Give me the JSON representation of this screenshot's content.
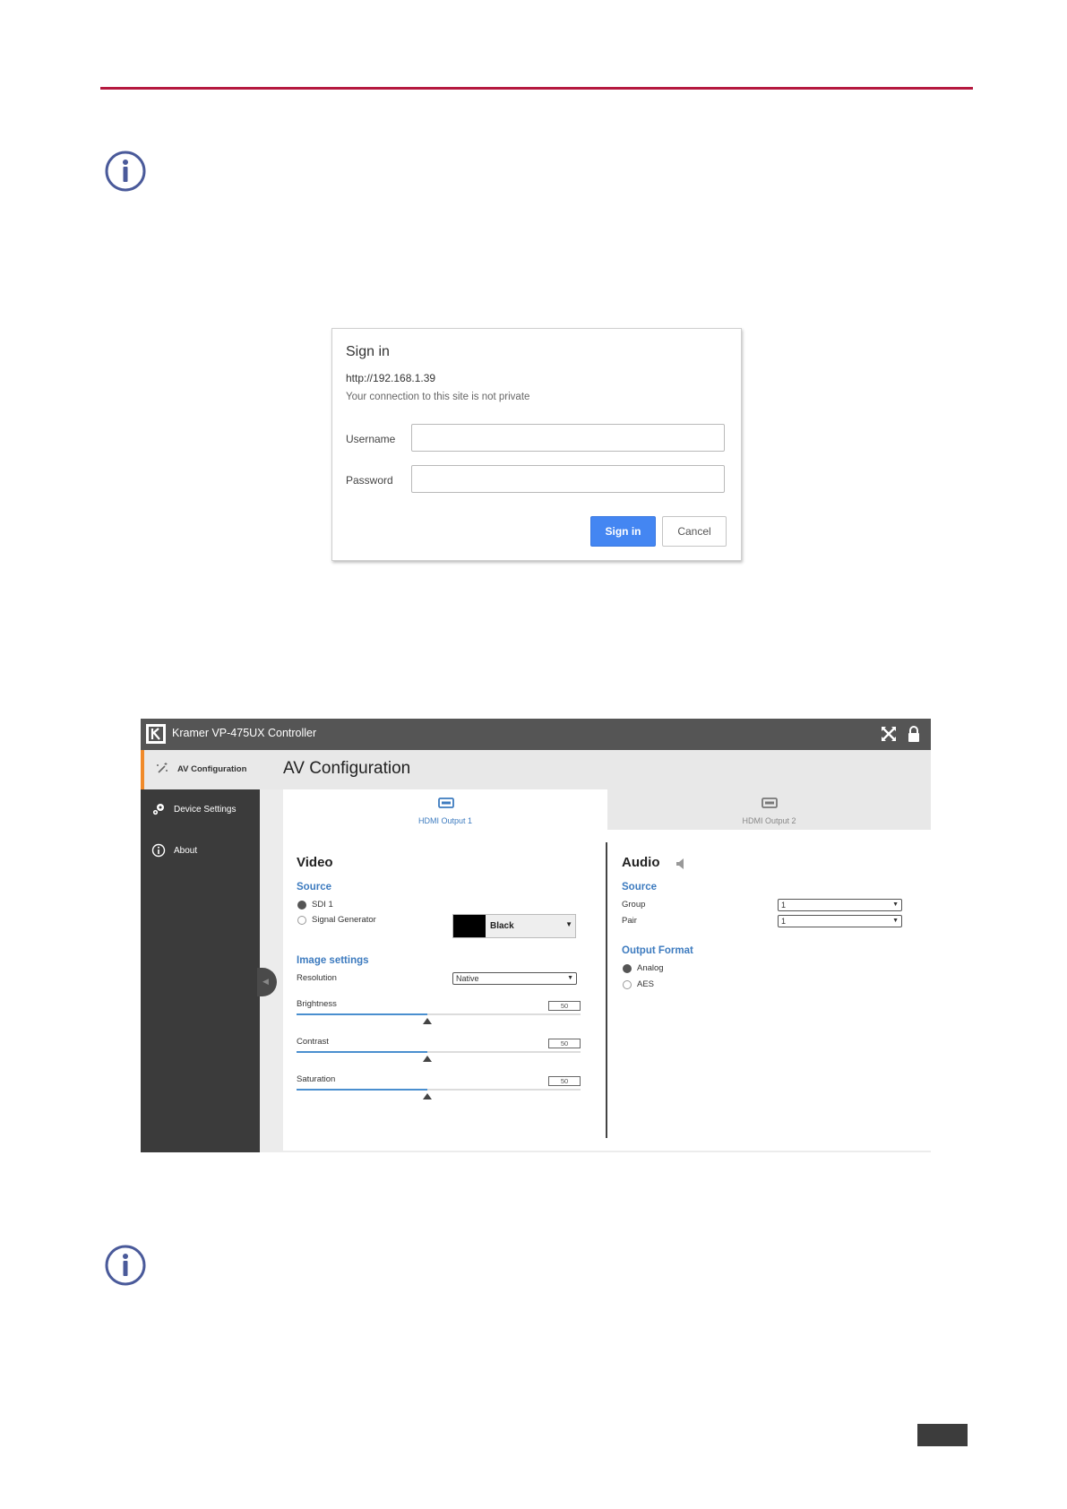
{
  "dialog": {
    "title": "Sign in",
    "url": "http://192.168.1.39",
    "warning": "Your connection to this site is not private",
    "username_label": "Username",
    "username_value": "",
    "password_label": "Password",
    "password_value": "",
    "signin_button": "Sign in",
    "cancel_button": "Cancel"
  },
  "controller": {
    "title": "Kramer VP-475UX Controller",
    "sidebar": {
      "items": [
        {
          "label": "AV Configuration",
          "icon": "wand-icon",
          "active": true
        },
        {
          "label": "Device Settings",
          "icon": "gears-icon",
          "active": false
        },
        {
          "label": "About",
          "icon": "info-icon",
          "active": false
        }
      ]
    },
    "page_title": "AV Configuration",
    "tabs": [
      {
        "label": "HDMI Output 1",
        "icon": "hdmi-icon",
        "active": true
      },
      {
        "label": "HDMI Output 2",
        "icon": "hdmi-icon",
        "active": false
      }
    ],
    "video": {
      "title": "Video",
      "source_title": "Source",
      "source_options": [
        {
          "label": "SDI 1",
          "selected": true
        },
        {
          "label": "Signal Generator",
          "selected": false
        }
      ],
      "pattern_value": "Black",
      "image_settings_title": "Image settings",
      "resolution_label": "Resolution",
      "resolution_value": "Native",
      "sliders": [
        {
          "label": "Brightness",
          "value": "50",
          "fraction": 0.46
        },
        {
          "label": "Contrast",
          "value": "50",
          "fraction": 0.46
        },
        {
          "label": "Saturation",
          "value": "50",
          "fraction": 0.46
        }
      ]
    },
    "audio": {
      "title": "Audio",
      "source_title": "Source",
      "group_label": "Group",
      "group_value": "1",
      "pair_label": "Pair",
      "pair_value": "1",
      "output_format_title": "Output Format",
      "format_options": [
        {
          "label": "Analog",
          "selected": true
        },
        {
          "label": "AES",
          "selected": false
        }
      ]
    }
  },
  "colors": {
    "rule": "#b5193f",
    "info_icon": "#4a5a9a",
    "primary_button": "#4486f2",
    "accent_orange": "#f08a2a",
    "link_blue": "#3d7bbf"
  }
}
